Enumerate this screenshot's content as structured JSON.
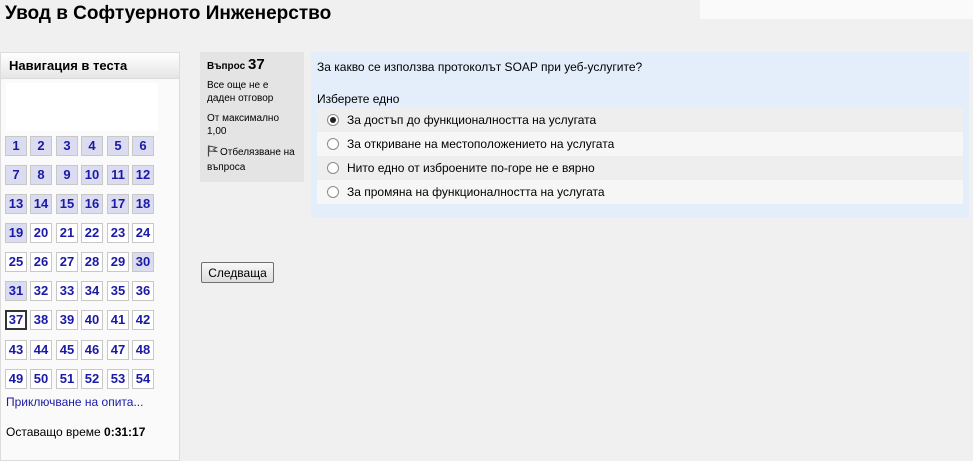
{
  "page": {
    "title": "Увод в Софтуерното Инженерство"
  },
  "nav": {
    "header": "Навигация в теста",
    "questions": [
      {
        "n": "1",
        "answered": true
      },
      {
        "n": "2",
        "answered": true
      },
      {
        "n": "3",
        "answered": true
      },
      {
        "n": "4",
        "answered": true
      },
      {
        "n": "5",
        "answered": true
      },
      {
        "n": "6",
        "answered": true
      },
      {
        "n": "7",
        "answered": true
      },
      {
        "n": "8",
        "answered": true
      },
      {
        "n": "9",
        "answered": true
      },
      {
        "n": "10",
        "answered": true
      },
      {
        "n": "11",
        "answered": true
      },
      {
        "n": "12",
        "answered": true
      },
      {
        "n": "13",
        "answered": true
      },
      {
        "n": "14",
        "answered": true
      },
      {
        "n": "15",
        "answered": true
      },
      {
        "n": "16",
        "answered": true
      },
      {
        "n": "17",
        "answered": true
      },
      {
        "n": "18",
        "answered": true
      },
      {
        "n": "19",
        "answered": true
      },
      {
        "n": "20",
        "answered": false
      },
      {
        "n": "21",
        "answered": false
      },
      {
        "n": "22",
        "answered": false
      },
      {
        "n": "23",
        "answered": false
      },
      {
        "n": "24",
        "answered": false
      },
      {
        "n": "25",
        "answered": false
      },
      {
        "n": "26",
        "answered": false
      },
      {
        "n": "27",
        "answered": false
      },
      {
        "n": "28",
        "answered": false
      },
      {
        "n": "29",
        "answered": false
      },
      {
        "n": "30",
        "answered": true
      },
      {
        "n": "31",
        "answered": true
      },
      {
        "n": "32",
        "answered": false
      },
      {
        "n": "33",
        "answered": false
      },
      {
        "n": "34",
        "answered": false
      },
      {
        "n": "35",
        "answered": false
      },
      {
        "n": "36",
        "answered": false
      },
      {
        "n": "37",
        "answered": false,
        "current": true
      },
      {
        "n": "38",
        "answered": false
      },
      {
        "n": "39",
        "answered": false
      },
      {
        "n": "40",
        "answered": false
      },
      {
        "n": "41",
        "answered": false
      },
      {
        "n": "42",
        "answered": false
      },
      {
        "n": "43",
        "answered": false
      },
      {
        "n": "44",
        "answered": false
      },
      {
        "n": "45",
        "answered": false
      },
      {
        "n": "46",
        "answered": false
      },
      {
        "n": "47",
        "answered": false
      },
      {
        "n": "48",
        "answered": false
      },
      {
        "n": "49",
        "answered": false
      },
      {
        "n": "50",
        "answered": false
      },
      {
        "n": "51",
        "answered": false
      },
      {
        "n": "52",
        "answered": false
      },
      {
        "n": "53",
        "answered": false
      },
      {
        "n": "54",
        "answered": false
      }
    ],
    "finish_link": "Приключване на опита...",
    "timer_label": "Оставащо време",
    "timer_value": "0:31:17"
  },
  "question_info": {
    "label": "Въпрос",
    "number": "37",
    "state": "Все още не е даден отговор",
    "grade": "От максимално 1,00",
    "flag_label": "Отбелязване на въпроса",
    "flag_icon": "flag-icon"
  },
  "question": {
    "text": "За какво се използва протоколът SOAP при уеб-услугите?",
    "prompt": "Изберете едно",
    "answers": [
      {
        "label": "За достъп до функционалността на услугата",
        "selected": true
      },
      {
        "label": "За откриване на местоположението на услугата",
        "selected": false
      },
      {
        "label": "Нито едно от изброените по-горе не е вярно",
        "selected": false
      },
      {
        "label": "За промяна на функционалността на услугата",
        "selected": false
      }
    ]
  },
  "buttons": {
    "next": "Следваща"
  },
  "colors": {
    "link": "#1a1aa6",
    "question_bg": "#e3eefa",
    "answered_bg": "#dcdcf0"
  }
}
